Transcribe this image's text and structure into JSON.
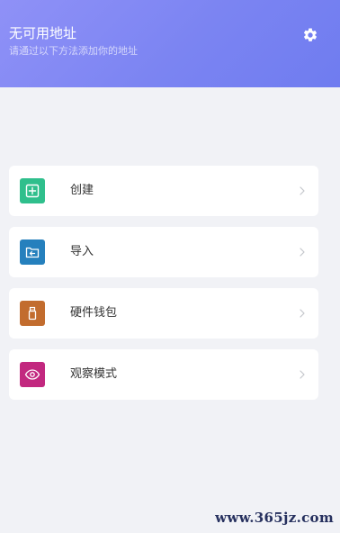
{
  "header": {
    "title": "无可用地址",
    "subtitle": "请通过以下方法添加你的地址",
    "settings_icon": "gear-icon",
    "gradient_start": "#8f91f7",
    "gradient_end": "#6f7cf0"
  },
  "menu": {
    "items": [
      {
        "label": "创建",
        "icon": "plus-square-icon",
        "color": "#2fbf8c"
      },
      {
        "label": "导入",
        "icon": "folder-import-icon",
        "color": "#2580bd"
      },
      {
        "label": "硬件钱包",
        "icon": "usb-drive-icon",
        "color": "#c26c2e"
      },
      {
        "label": "观察模式",
        "icon": "eye-icon",
        "color": "#c2287f"
      }
    ],
    "chevron_icon": "chevron-right-icon"
  },
  "watermark": {
    "text": "www.365jz.com"
  }
}
